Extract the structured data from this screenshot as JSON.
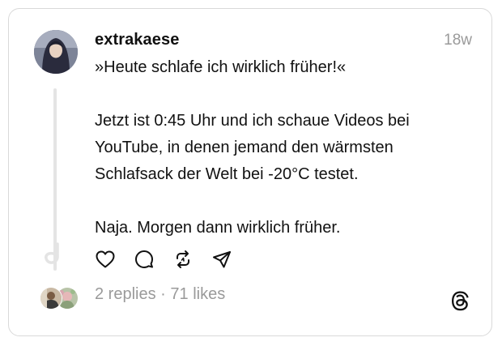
{
  "post": {
    "username": "extrakaese",
    "timestamp": "18w",
    "lines": [
      "»Heute schlafe ich wirklich früher!«",
      "Jetzt ist 0:45 Uhr und ich schaue Videos bei YouTube, in denen jemand den wärmsten Schlafsack der Welt bei -20°C testet.",
      "Naja. Morgen dann wirklich früher."
    ]
  },
  "actions": {
    "icons": [
      "heart-icon",
      "comment-icon",
      "repost-icon",
      "share-icon"
    ]
  },
  "footer": {
    "replies": "2 replies",
    "separator": " · ",
    "likes": "71 likes",
    "logo_icon": "threads-logo-icon"
  },
  "colors": {
    "text": "#111111",
    "muted": "#9a9a9a",
    "border": "#d9d9d9",
    "thread_line": "#e4e4e4"
  }
}
